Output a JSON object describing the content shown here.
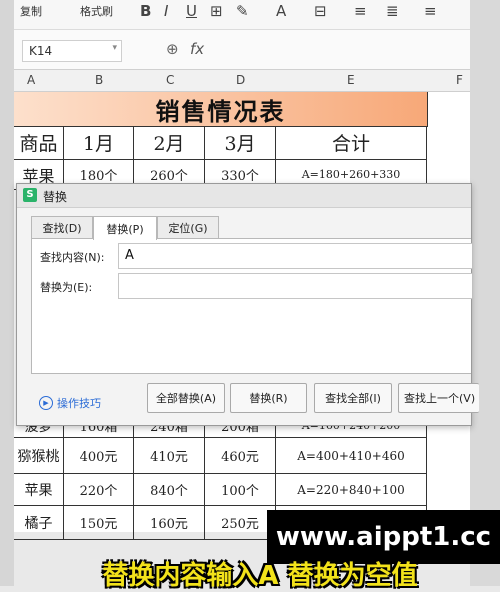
{
  "ribbon": {
    "paste_label": "复制",
    "format_painter_label": "格式刷",
    "bold": "B",
    "italic": "I",
    "underline": "U"
  },
  "formula_bar": {
    "cell_ref": "K14",
    "fx": "fx"
  },
  "columns": [
    "A",
    "B",
    "C",
    "D",
    "E",
    "F"
  ],
  "sheet": {
    "title": "销售情况表",
    "headers": [
      "商品",
      "1月",
      "2月",
      "3月",
      "合计"
    ],
    "rows": [
      [
        "苹果",
        "180个",
        "260个",
        "330个",
        "A=180+260+330"
      ],
      [
        "菠萝",
        "160箱",
        "240箱",
        "200箱",
        "A=160+240+200"
      ],
      [
        "猕猴桃",
        "400元",
        "410元",
        "460元",
        "A=400+410+460"
      ],
      [
        "苹果",
        "220个",
        "840个",
        "100个",
        "A=220+840+100"
      ],
      [
        "橘子",
        "150元",
        "160元",
        "250元",
        ""
      ]
    ]
  },
  "dialog": {
    "title": "替换",
    "tabs": [
      "查找(D)",
      "替换(P)",
      "定位(G)"
    ],
    "find_label": "查找内容(N):",
    "find_value": "A",
    "replace_label": "替换为(E):",
    "replace_value": "",
    "tips_label": "操作技巧",
    "buttons": [
      "全部替换(A)",
      "替换(R)",
      "查找全部(I)",
      "查找上一个(V)"
    ]
  },
  "watermark": "www.aippt1.cc",
  "caption": "替换内容输入A 替换为空值"
}
